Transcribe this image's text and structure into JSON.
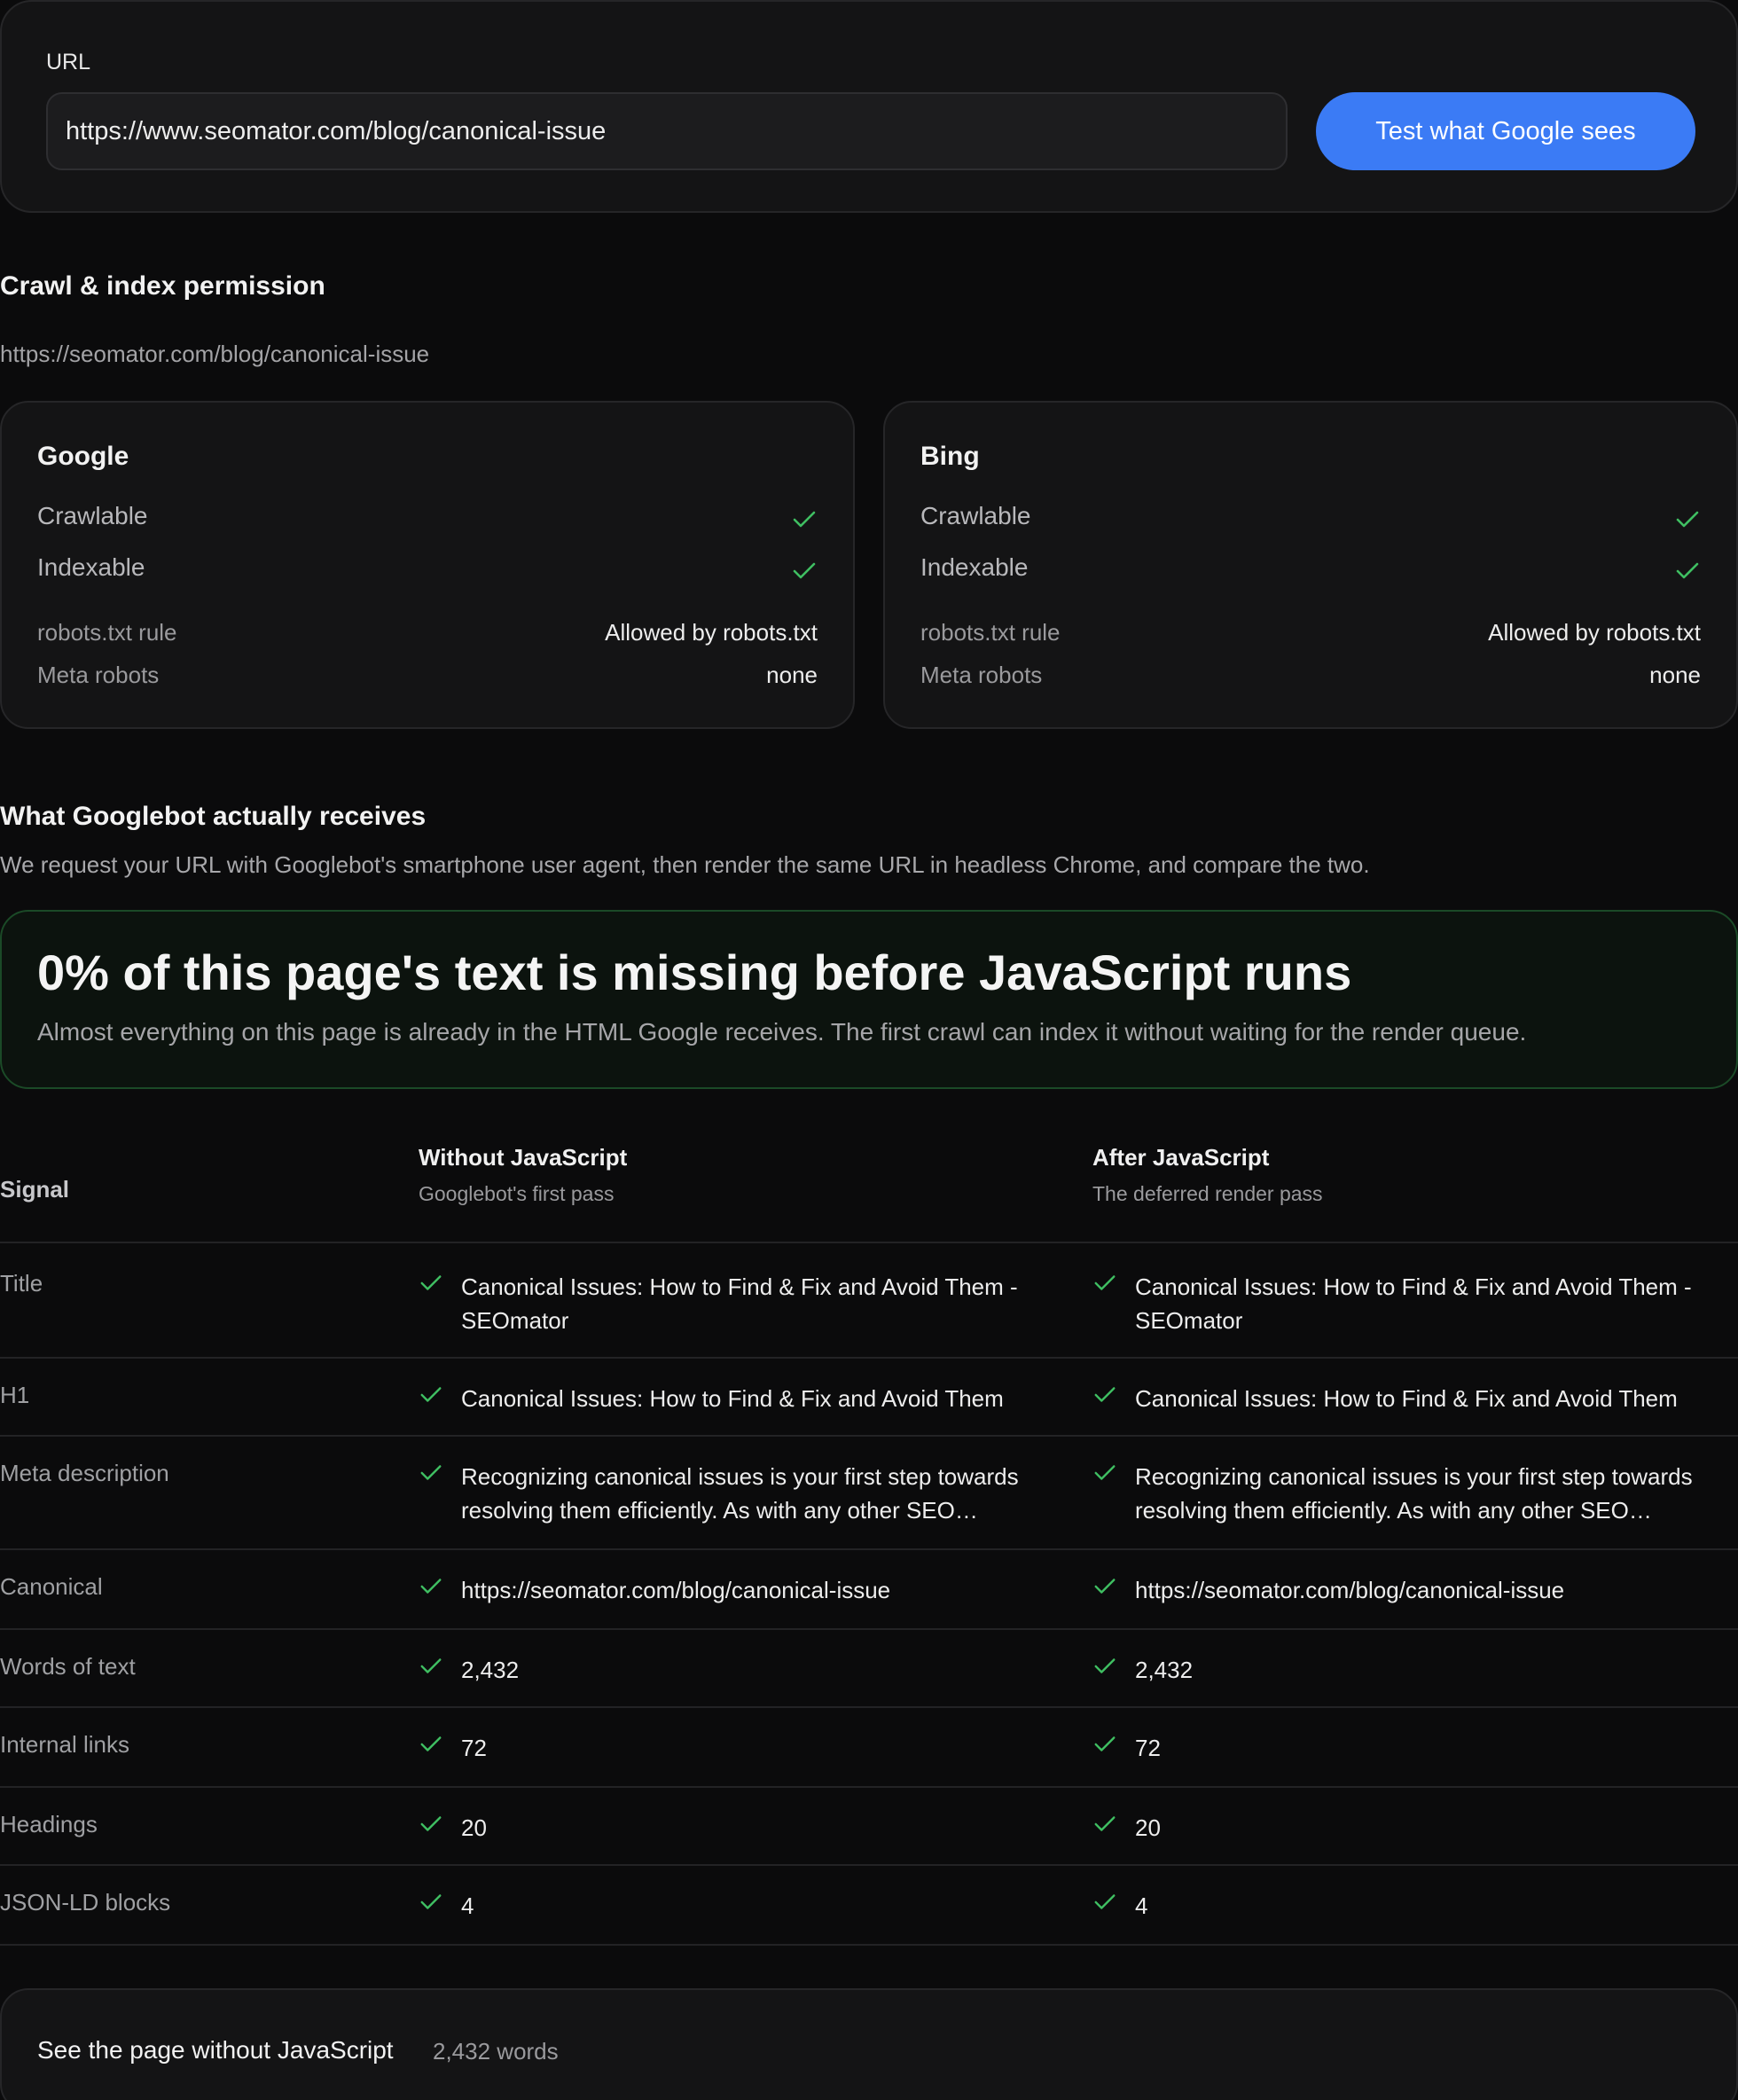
{
  "url_form": {
    "label": "URL",
    "value": "https://www.seomator.com/blog/canonical-issue",
    "button_label": "Test what Google sees",
    "accent_color": "#3b7bf5"
  },
  "crawl": {
    "title": "Crawl & index permission",
    "url": "https://seomator.com/blog/canonical-issue",
    "engines": [
      {
        "name": "Google",
        "checks": [
          "Crawlable",
          "Indexable"
        ],
        "robots_label": "robots.txt rule",
        "robots_value": "Allowed by robots.txt",
        "meta_label": "Meta robots",
        "meta_value": "none"
      },
      {
        "name": "Bing",
        "checks": [
          "Crawlable",
          "Indexable"
        ],
        "robots_label": "robots.txt rule",
        "robots_value": "Allowed by robots.txt",
        "meta_label": "Meta robots",
        "meta_value": "none"
      }
    ],
    "ok_color": "#3fbf62"
  },
  "googlebot": {
    "title": "What Googlebot actually receives",
    "description": "We request your URL with Googlebot's smartphone user agent, then render the same URL in headless Chrome, and compare the two.",
    "banner_title": "0% of this page's text is missing before JavaScript runs",
    "banner_text": "Almost everything on this page is already in the HTML Google receives. The first crawl can index it without waiting for the render queue."
  },
  "table": {
    "col_signal": "Signal",
    "col_without_title": "Without JavaScript",
    "col_without_sub": "Googlebot's first pass",
    "col_after_title": "After JavaScript",
    "col_after_sub": "The deferred render pass",
    "rows": [
      {
        "label": "Title",
        "without": "Canonical Issues: How to Find & Fix and Avoid Them - SEOmator",
        "after": "Canonical Issues: How to Find & Fix and Avoid Them - SEOmator"
      },
      {
        "label": "H1",
        "without": "Canonical Issues: How to Find & Fix and Avoid Them",
        "after": "Canonical Issues: How to Find & Fix and Avoid Them"
      },
      {
        "label": "Meta description",
        "without": "Recognizing canonical issues is your first step towards resolving them efficiently. As with any other SEO…",
        "after": "Recognizing canonical issues is your first step towards resolving them efficiently. As with any other SEO…"
      },
      {
        "label": "Canonical",
        "without": "https://seomator.com/blog/canonical-issue",
        "after": "https://seomator.com/blog/canonical-issue"
      },
      {
        "label": "Words of text",
        "without": "2,432",
        "after": "2,432"
      },
      {
        "label": "Internal links",
        "without": "72",
        "after": "72"
      },
      {
        "label": "Headings",
        "without": "20",
        "after": "20"
      },
      {
        "label": "JSON-LD blocks",
        "without": "4",
        "after": "4"
      }
    ]
  },
  "footer": {
    "title": "See the page without JavaScript",
    "count": "2,432 words"
  }
}
